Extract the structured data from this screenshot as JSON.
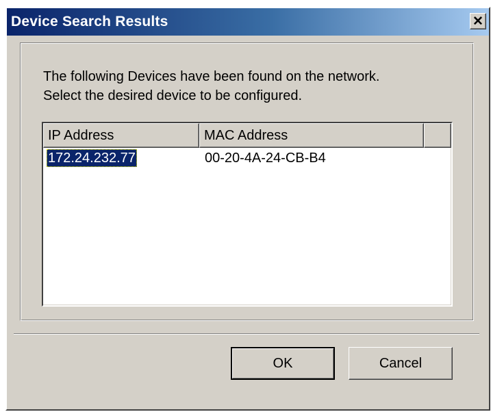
{
  "dialog": {
    "title": "Device Search Results",
    "close_glyph": "✕"
  },
  "instruction": {
    "line1": "The following Devices have been found on the network.",
    "line2": "Select the desired device to be configured."
  },
  "device_list": {
    "columns": [
      "IP Address",
      "MAC Address",
      ""
    ],
    "rows": [
      {
        "ip": "172.24.232.77",
        "mac": "00-20-4A-24-CB-B4",
        "selected": true
      }
    ]
  },
  "buttons": {
    "ok": "OK",
    "cancel": "Cancel"
  },
  "colors": {
    "title_gradient_start": "#0a246a",
    "title_gradient_end": "#a6caf0",
    "face": "#d4d0c8",
    "selection": "#0a246a"
  }
}
